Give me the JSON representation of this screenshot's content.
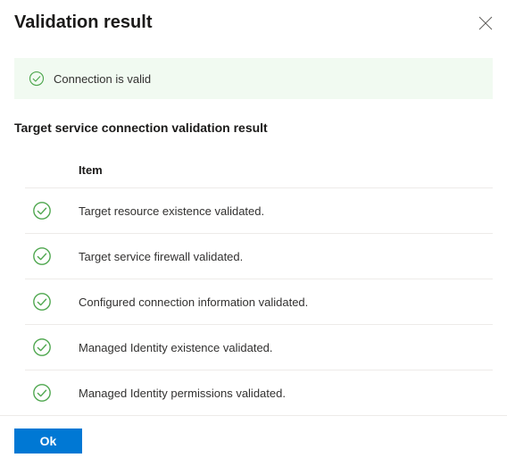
{
  "header": {
    "title": "Validation result"
  },
  "status": {
    "message": "Connection is valid"
  },
  "section": {
    "title": "Target service connection validation result",
    "column_header": "Item"
  },
  "items": [
    {
      "label": "Target resource existence validated."
    },
    {
      "label": "Target service firewall validated."
    },
    {
      "label": "Configured connection information validated."
    },
    {
      "label": "Managed Identity existence validated."
    },
    {
      "label": "Managed Identity permissions validated."
    }
  ],
  "footer": {
    "ok_label": "Ok"
  }
}
